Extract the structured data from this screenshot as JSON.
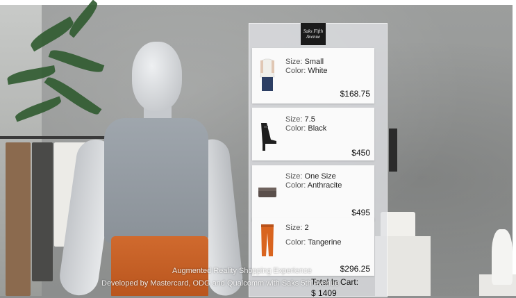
{
  "brand": {
    "logo_text": "Saks Fifth Avenue"
  },
  "cart": {
    "items": [
      {
        "size_label": "Size:",
        "size": "Small",
        "color_label": "Color:",
        "color": "White",
        "price": "$168.75",
        "product_icon": "white-blouse-icon"
      },
      {
        "size_label": "Size:",
        "size": "7.5",
        "color_label": "Color:",
        "color": "Black",
        "price": "$450",
        "product_icon": "black-sandal-icon"
      },
      {
        "size_label": "Size:",
        "size": "One Size",
        "color_label": "Color:",
        "color": "Anthracite",
        "price": "$495",
        "product_icon": "clutch-bag-icon"
      },
      {
        "size_label": "Size:",
        "size": "2",
        "color_label": "Color:",
        "color": "Tangerine",
        "price": "$296.25",
        "product_icon": "orange-pants-icon"
      }
    ],
    "total_label": "Total In Cart:",
    "total_value": "$ 1409"
  },
  "caption": {
    "line1": "Augmented Reality Shopping Experience",
    "line2": "Developed by Mastercard, ODG and Qualcomm with Saks 5th Avenue"
  },
  "colors": {
    "panel_bg": "#e0e2e6",
    "card_bg": "#fafafa",
    "skirt_orange": "#c4611f",
    "blouse_gray": "#97a0a8"
  }
}
